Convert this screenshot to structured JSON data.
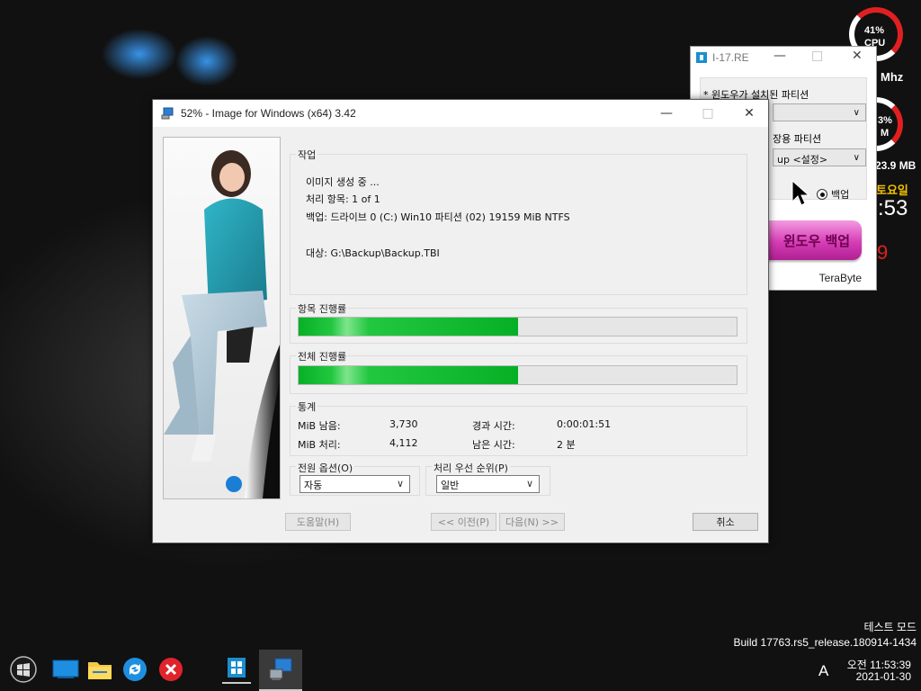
{
  "desktop": {
    "cpu_pct": "41%",
    "cpu_label": "CPU",
    "mhz": "Mhz",
    "ram_pct": "3%",
    "ram_label": "M",
    "ram_mb": "23.9 MB",
    "day": "토요일",
    "time_fragment": ":53",
    "seconds_fragment": "9",
    "watermark_line1": "테스트 모드",
    "watermark_line2": "Build 17763.rs5_release.180914-1434"
  },
  "re_window": {
    "title": "I-17.RE",
    "label_partition": "* 윈도우가 설치된 파티션",
    "label_save": "장용 파티션",
    "combo2_value": "up  <설정>",
    "radio_backup": "백업",
    "backup_button": "윈도우 백업",
    "brand": "TeraByte"
  },
  "main_window": {
    "title": "52% - Image for Windows (x64) 3.42",
    "task_group": "작업",
    "status": "이미지 생성 중 ...",
    "items_line": "처리 항목: 1 of 1",
    "backup_line": "백업: 드라이브 0 (C:) Win10 파티션 (02) 19159 MiB NTFS",
    "target_line": "대상: G:\\Backup\\Backup.TBI",
    "item_progress_label": "항목 진행률",
    "item_progress": 0.5,
    "total_progress_label": "전체 진행률",
    "total_progress": 0.5,
    "stats_label": "통계",
    "mib_left_label": "MiB 남음:",
    "mib_left": "3,730",
    "elapsed_label": "경과 시간:",
    "elapsed": "0:00:01:51",
    "mib_done_label": "MiB 처리:",
    "mib_done": "4,112",
    "remaining_label": "남은 시간:",
    "remaining": "2 분",
    "power_label": "전원 옵션(O)",
    "power_value": "자동",
    "priority_label": "처리 우선 순위(P)",
    "priority_value": "일반",
    "help_btn": "도움말(H)",
    "prev_btn": "<< 이전(P)",
    "next_btn": "다음(N) >>",
    "cancel_btn": "취소"
  },
  "taskbar": {
    "ime": "A",
    "clock_time": "오전 11:53:39",
    "clock_date": "2021-01-30"
  },
  "colors": {
    "progress": "#06b025",
    "accent_red": "#e02020",
    "re_button": "#d63db5"
  }
}
